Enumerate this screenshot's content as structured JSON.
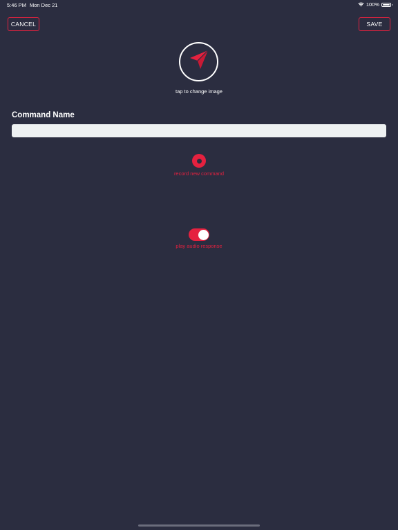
{
  "status_bar": {
    "time": "5:46 PM",
    "date": "Mon Dec 21",
    "battery": "100%",
    "icons": [
      "wifi-icon",
      "battery-icon"
    ]
  },
  "nav": {
    "cancel_label": "CANCEL",
    "save_label": "SAVE"
  },
  "image_picker": {
    "icon": "paper-plane-icon",
    "caption": "tap to change image"
  },
  "command_name": {
    "label": "Command Name",
    "value": "",
    "placeholder": ""
  },
  "record": {
    "icon": "record-icon",
    "label": "record new command"
  },
  "audio_response": {
    "enabled": true,
    "label": "play audio response"
  },
  "colors": {
    "background": "#2b2d40",
    "accent": "#e5213f",
    "input_background": "#eef1f2",
    "text": "#ffffff"
  }
}
